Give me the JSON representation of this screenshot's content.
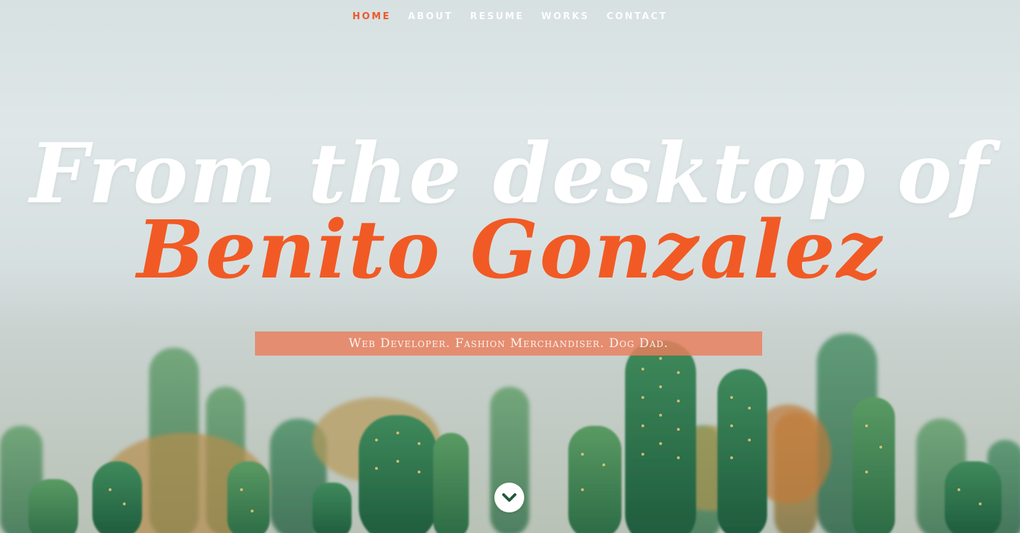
{
  "nav": {
    "items": [
      {
        "label": "HOME",
        "active": true
      },
      {
        "label": "ABOUT",
        "active": false
      },
      {
        "label": "RESUME",
        "active": false
      },
      {
        "label": "WORKS",
        "active": false
      },
      {
        "label": "CONTACT",
        "active": false
      }
    ]
  },
  "hero": {
    "line1": "From the desktop of",
    "line2": "Benito Gonzalez",
    "tagline": "Web Developer. Fashion Merchandiser. Dog Dad.",
    "scroll_icon": "chevron-down-icon",
    "background_image": "cactus-field-photo"
  },
  "colors": {
    "accent": "#f15a24",
    "nav_text": "#ffffff",
    "tagline_bg": "#ec7e5b"
  }
}
